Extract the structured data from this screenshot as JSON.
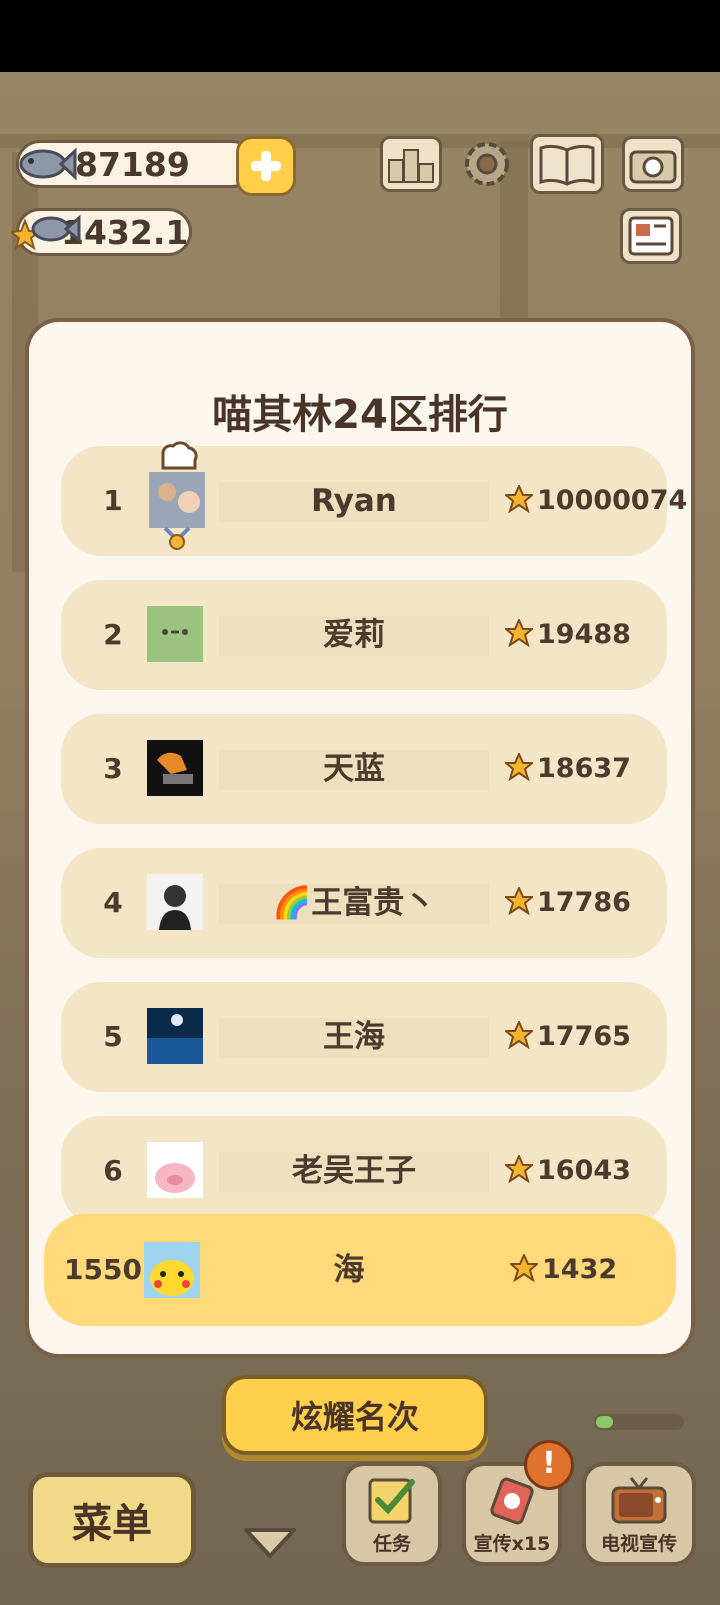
{
  "currency": {
    "fish": "87189",
    "star_fish": "1432.1"
  },
  "ranking": {
    "title": "喵其林24区排行",
    "rows": [
      {
        "rank": "1",
        "name": "Ryan",
        "score": "10000074"
      },
      {
        "rank": "2",
        "name": "爱莉",
        "score": "19488"
      },
      {
        "rank": "3",
        "name": "天蓝",
        "score": "18637"
      },
      {
        "rank": "4",
        "name": "🌈王富贵丶",
        "score": "17786"
      },
      {
        "rank": "5",
        "name": "王海",
        "score": "17765"
      },
      {
        "rank": "6",
        "name": "老吴王子",
        "score": "16043"
      }
    ],
    "me": {
      "rank": "1550",
      "name": "海",
      "score": "1432"
    }
  },
  "buttons": {
    "show_rank": "炫耀名次",
    "menu": "菜单",
    "tasks": "任务",
    "promote": "宣传x15",
    "tv_promote": "电视宣传",
    "badge": "!"
  },
  "progress": 0.2,
  "colors": {
    "panel_bg": "#fcf7ee",
    "row_bg": "#f3e5c6",
    "highlight_row": "#ffd97a",
    "button_yellow": "#ffd04c"
  }
}
